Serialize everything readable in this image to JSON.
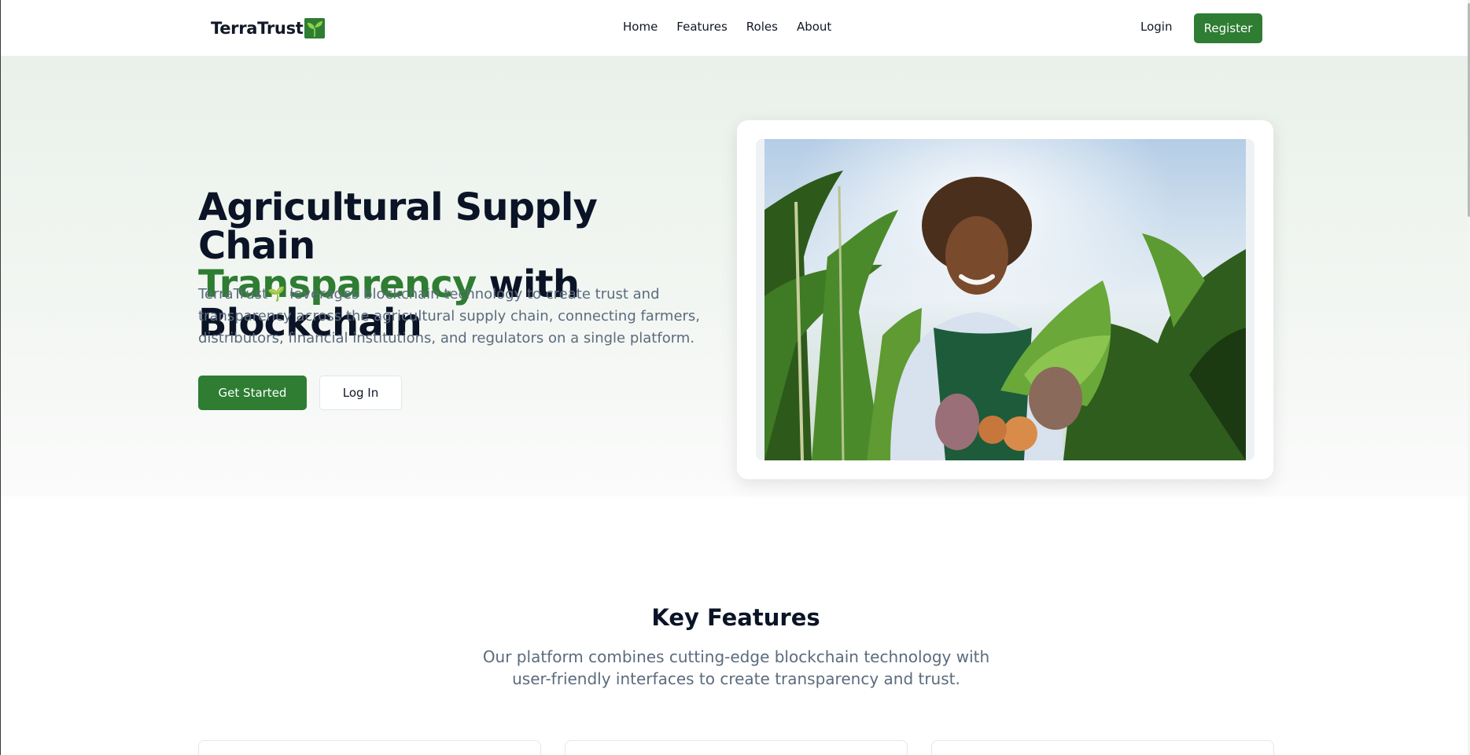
{
  "header": {
    "logo_text": "TerraTrust",
    "logo_icon": "seedling-icon",
    "nav": [
      "Home",
      "Features",
      "Roles",
      "About"
    ],
    "login_label": "Login",
    "register_label": "Register"
  },
  "hero": {
    "title_line1": "Agricultural Supply Chain",
    "title_accent": "Transparency",
    "title_rest": " with Blockchain",
    "description": "TerraTrust🌱 leverages blockchain technology to create trust and transparency across the agricultural supply chain, connecting farmers, distributors, financial institutions, and regulators on a single platform.",
    "primary_button": "Get Started",
    "secondary_button": "Log In",
    "image_alt": "woman farmer holding vegetables in a cornfield"
  },
  "features": {
    "title": "Key Features",
    "subtitle": "Our platform combines cutting-edge blockchain technology with user-friendly interfaces to create transparency and trust."
  },
  "colors": {
    "brand_green": "#2e7d32",
    "heading": "#0b1426",
    "body_text": "#5b6b7d",
    "hero_bg_top": "#e9f1ea"
  }
}
